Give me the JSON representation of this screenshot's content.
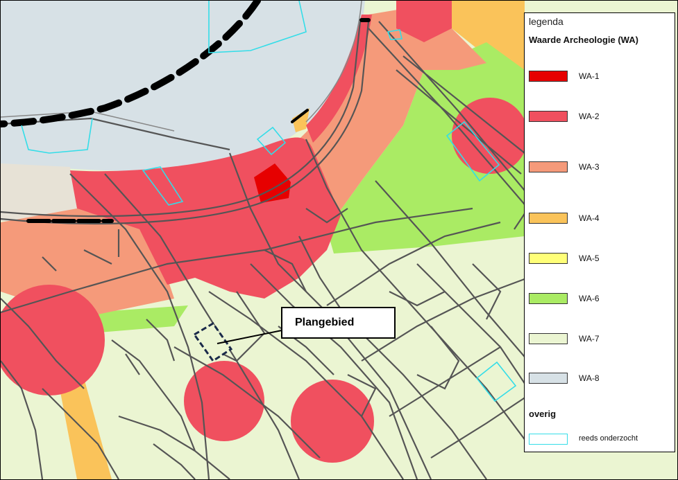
{
  "legend": {
    "title": "legenda",
    "heading": "Waarde Archeologie (WA)",
    "items": [
      {
        "label": "WA-1",
        "color": "#e60000"
      },
      {
        "label": "WA-2",
        "color": "#f0505f"
      },
      {
        "label": "WA-3",
        "color": "#f59a7a"
      },
      {
        "label": "WA-4",
        "color": "#fac35a"
      },
      {
        "label": "WA-5",
        "color": "#ffff78"
      },
      {
        "label": "WA-6",
        "color": "#aaeb64"
      },
      {
        "label": "WA-7",
        "color": "#ebf5d2"
      },
      {
        "label": "WA-8",
        "color": "#d7e1e6"
      }
    ],
    "other_heading": "overig",
    "other_items": [
      {
        "label": "reeds onderzocht",
        "color": "#33dde8"
      }
    ]
  },
  "callout": {
    "label": "Plangebied"
  },
  "colors": {
    "river": "#d7e1e6",
    "road_lines": "#555555",
    "dike_line": "#000000",
    "investigated_outline": "#33dde8",
    "plan_outline": "#1a2a4a"
  }
}
